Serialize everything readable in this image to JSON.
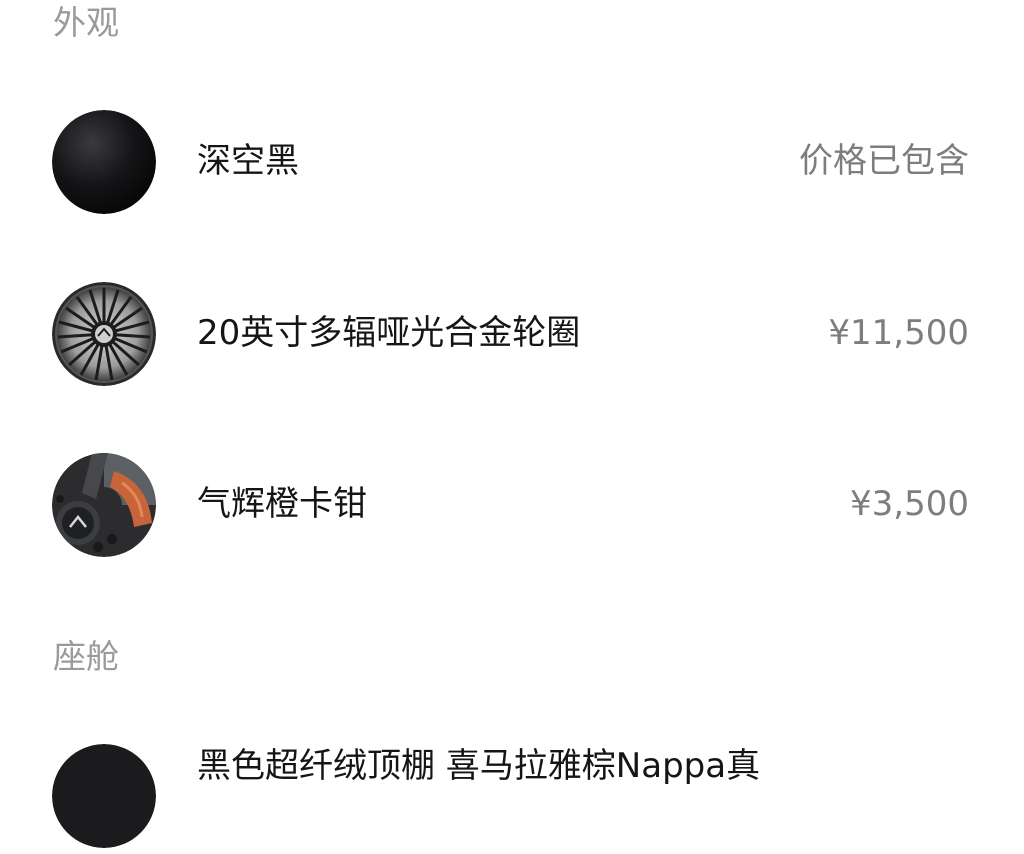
{
  "sections": [
    {
      "title": "外观",
      "items": [
        {
          "label": "深空黑",
          "price": "价格已包含",
          "icon": "black-paint-swatch-icon"
        },
        {
          "label": "20英寸多辐哑光合金轮圈",
          "price": "¥11,500",
          "icon": "alloy-wheel-icon"
        },
        {
          "label": "气辉橙卡钳",
          "price": "¥3,500",
          "icon": "orange-caliper-icon"
        }
      ]
    },
    {
      "title": "座舱",
      "items": [
        {
          "label": "黑色超纤绒顶棚 喜马拉雅棕Nappa真",
          "price": "",
          "icon": "headliner-swatch-icon"
        }
      ]
    }
  ],
  "colors": {
    "section_title": "#9a9a9a",
    "item_text": "#151515",
    "price_text": "#7d7d7d",
    "caliper_orange": "#c8643a"
  }
}
